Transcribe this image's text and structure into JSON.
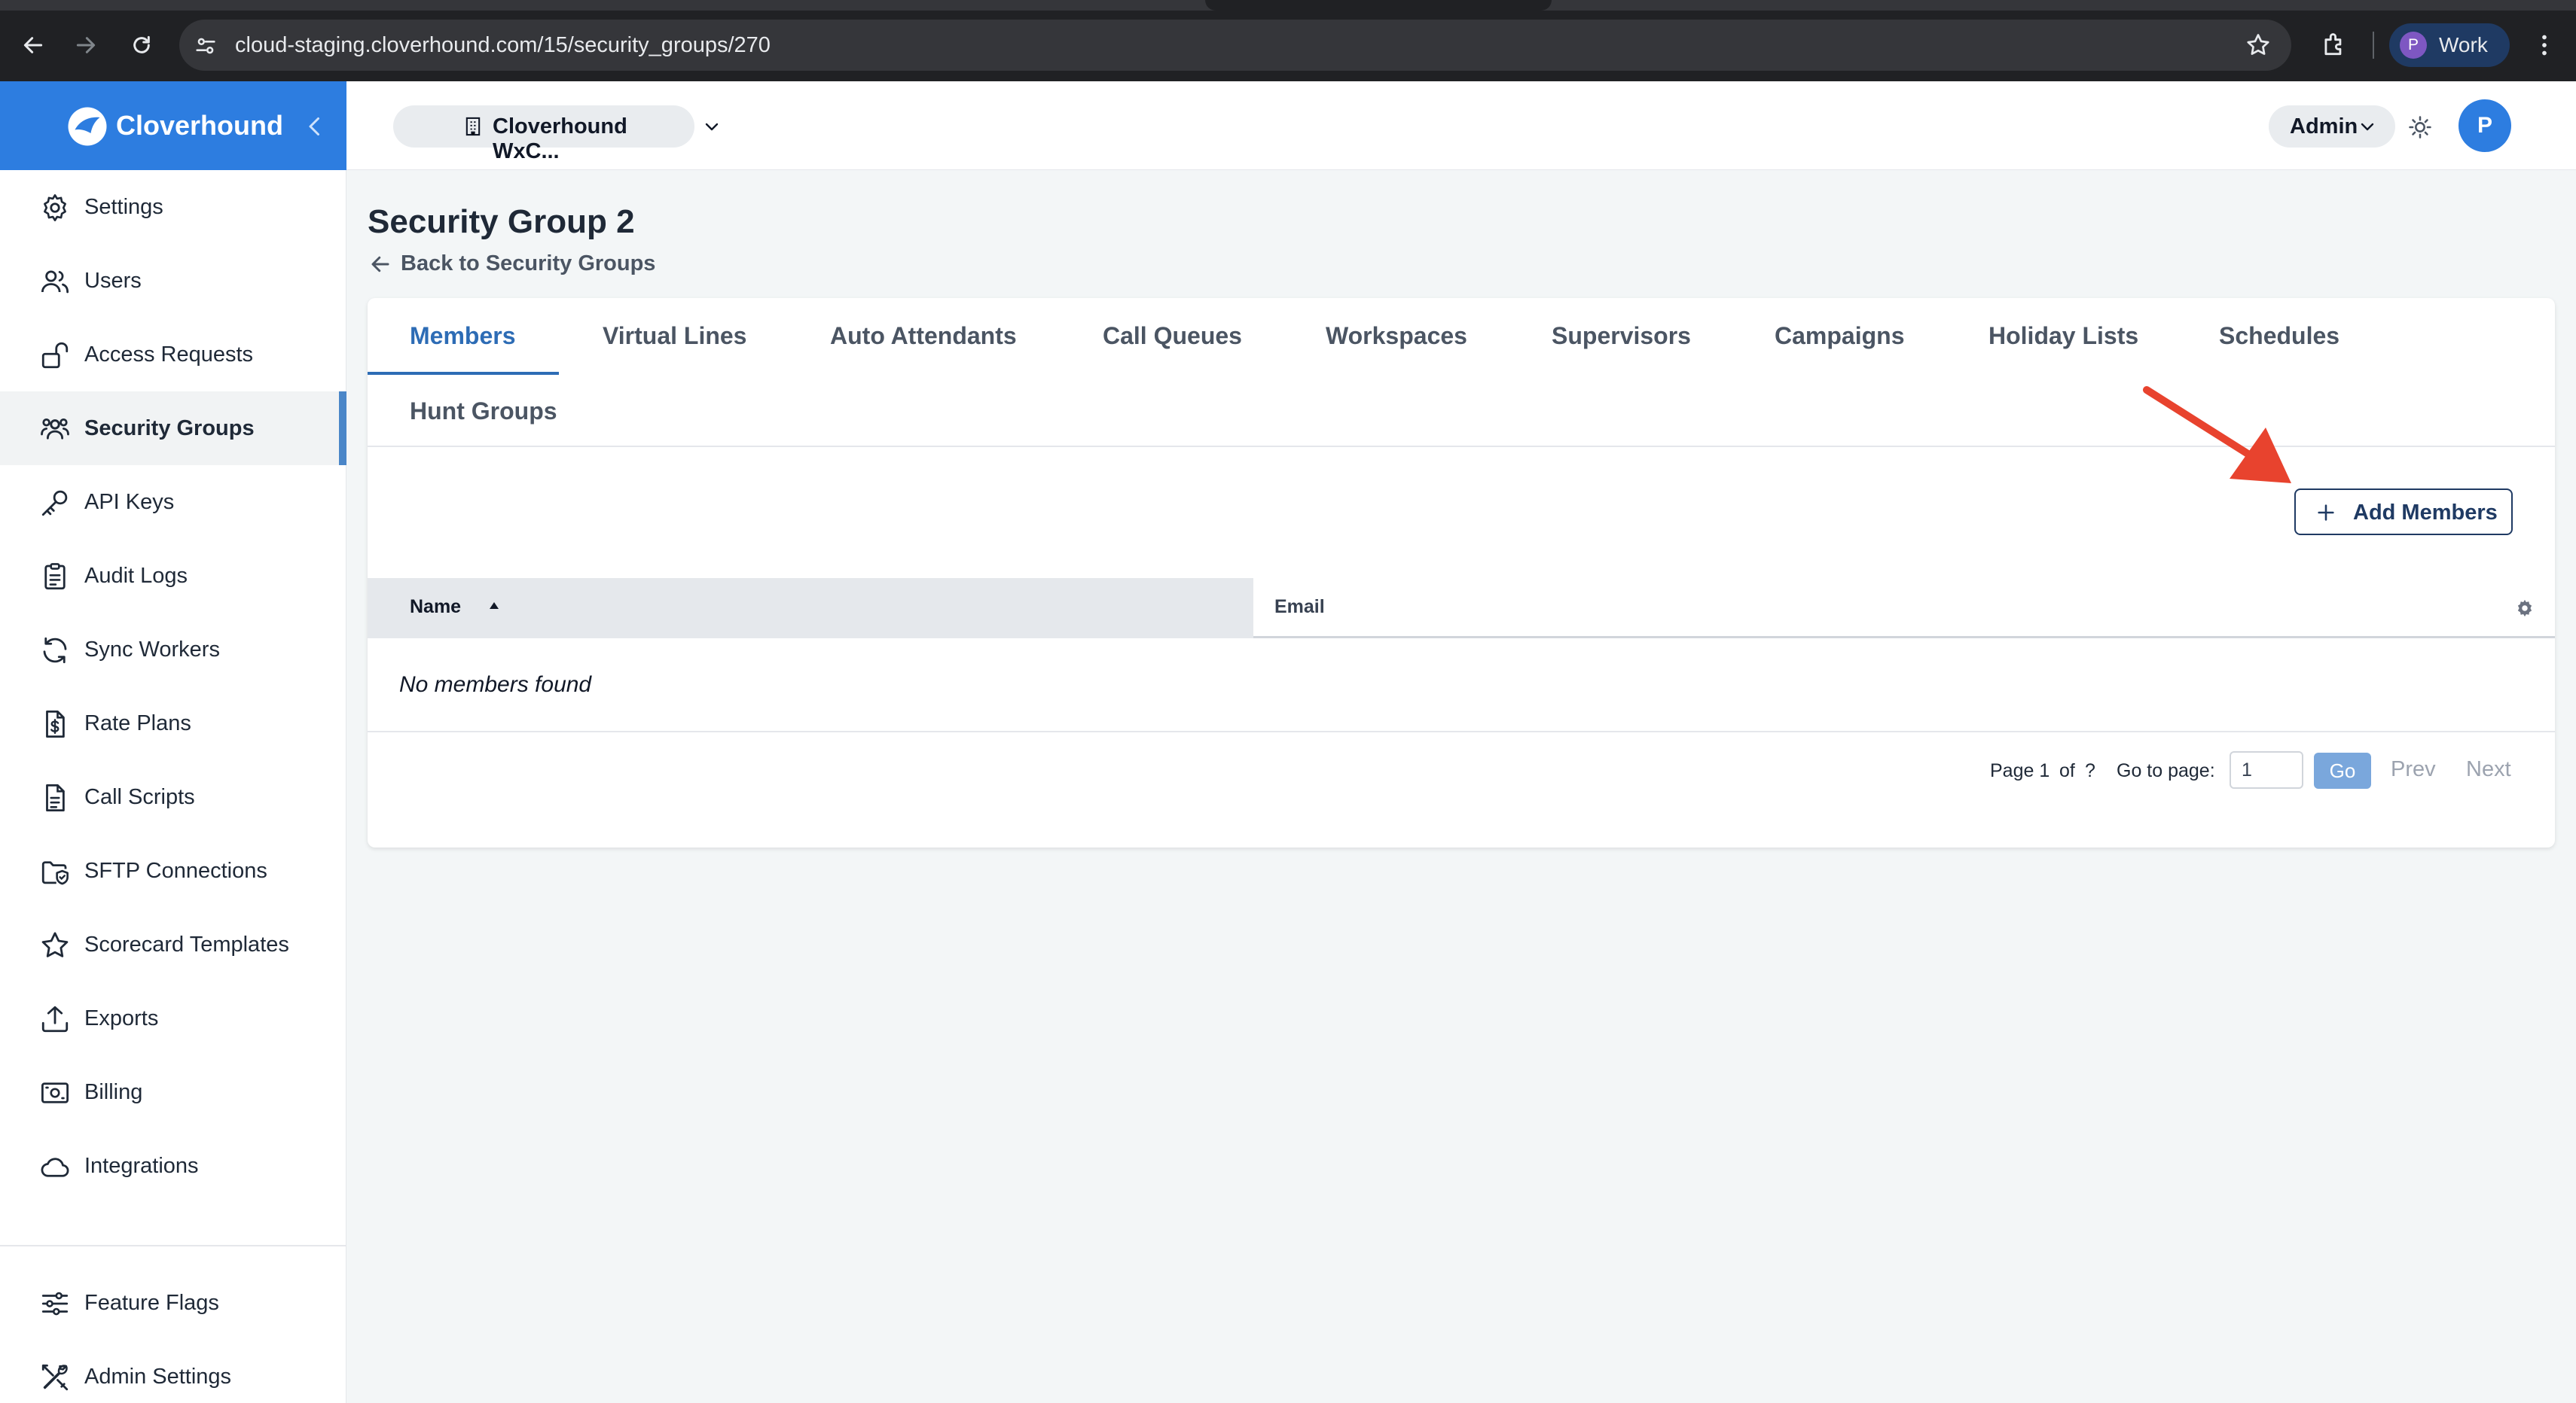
{
  "browser": {
    "url": "cloud-staging.cloverhound.com/15/security_groups/270",
    "profile_initial": "P",
    "profile_label": "Work"
  },
  "brand": {
    "name": "Cloverhound"
  },
  "sidebar": {
    "items": [
      {
        "label": "Settings",
        "icon": "gear-icon"
      },
      {
        "label": "Users",
        "icon": "users-icon"
      },
      {
        "label": "Access Requests",
        "icon": "unlock-icon"
      },
      {
        "label": "Security Groups",
        "icon": "group-icon",
        "active": true
      },
      {
        "label": "API Keys",
        "icon": "key-icon"
      },
      {
        "label": "Audit Logs",
        "icon": "clipboard-icon"
      },
      {
        "label": "Sync Workers",
        "icon": "refresh-icon"
      },
      {
        "label": "Rate Plans",
        "icon": "dollar-doc-icon"
      },
      {
        "label": "Call Scripts",
        "icon": "document-icon"
      },
      {
        "label": "SFTP Connections",
        "icon": "shield-folder-icon"
      },
      {
        "label": "Scorecard Templates",
        "icon": "star-icon"
      },
      {
        "label": "Exports",
        "icon": "upload-icon"
      },
      {
        "label": "Billing",
        "icon": "banknote-icon"
      },
      {
        "label": "Integrations",
        "icon": "cloud-icon"
      }
    ],
    "bottom_items": [
      {
        "label": "Feature Flags",
        "icon": "sliders-icon"
      },
      {
        "label": "Admin Settings",
        "icon": "tools-icon"
      }
    ]
  },
  "header": {
    "org_label": "Cloverhound WxC...",
    "role_label": "Admin",
    "avatar_initial": "P"
  },
  "page": {
    "title": "Security Group 2",
    "back_label": "Back to Security Groups"
  },
  "tabs": [
    {
      "label": "Members",
      "active": true
    },
    {
      "label": "Virtual Lines"
    },
    {
      "label": "Auto Attendants"
    },
    {
      "label": "Call Queues"
    },
    {
      "label": "Workspaces"
    },
    {
      "label": "Supervisors"
    },
    {
      "label": "Campaigns"
    },
    {
      "label": "Holiday Lists"
    },
    {
      "label": "Schedules"
    },
    {
      "label": "Hunt Groups"
    }
  ],
  "actions": {
    "add_members_label": "Add Members"
  },
  "table": {
    "columns": [
      "Name",
      "Email"
    ],
    "empty_text": "No members found"
  },
  "pagination": {
    "page_label": "Page 1",
    "of_label": "of",
    "total_label": "?",
    "goto_label": "Go to page:",
    "page_input_value": "1",
    "go_label": "Go",
    "prev_label": "Prev",
    "next_label": "Next"
  },
  "colors": {
    "brand": "#2d7de0",
    "active_tab": "#2d6cb5",
    "annotation_arrow": "#e8432e"
  }
}
